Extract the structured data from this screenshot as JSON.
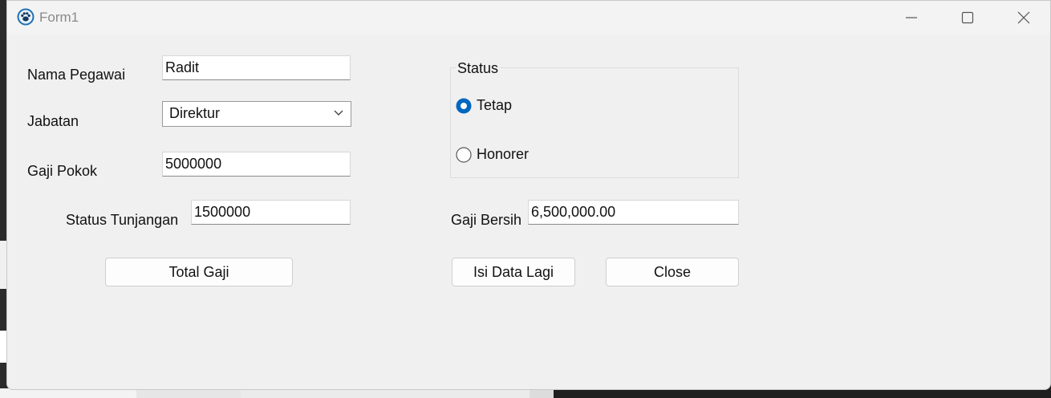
{
  "window": {
    "title": "Form1"
  },
  "form": {
    "nama_pegawai_label": "Nama Pegawai",
    "nama_pegawai_value": "Radit",
    "jabatan_label": "Jabatan",
    "jabatan_selected": "Direktur",
    "gaji_pokok_label": "Gaji Pokok",
    "gaji_pokok_value": "5000000",
    "status_tunjangan_label": "Status Tunjangan",
    "status_tunjangan_value": "1500000",
    "gaji_bersih_label": "Gaji Bersih",
    "gaji_bersih_value": "6,500,000.00"
  },
  "status_group": {
    "title": "Status",
    "options": [
      {
        "label": "Tetap",
        "checked": true
      },
      {
        "label": "Honorer",
        "checked": false
      }
    ]
  },
  "buttons": {
    "total_gaji": "Total Gaji",
    "isi_data_lagi": "Isi Data Lagi",
    "close": "Close"
  },
  "colors": {
    "accent": "#0067c0",
    "window_bg": "#f0f0f0"
  },
  "icons": {
    "app": "paw-icon",
    "minimize": "minimize-icon",
    "maximize": "maximize-icon",
    "close": "close-icon",
    "dropdown": "chevron-down-icon"
  }
}
